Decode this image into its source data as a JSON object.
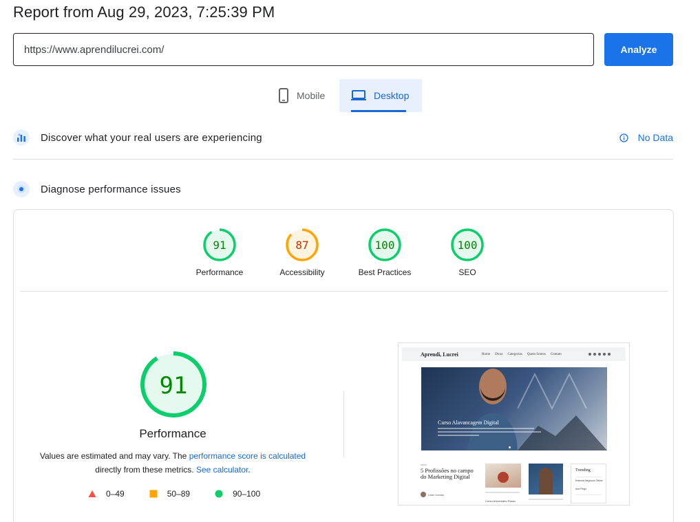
{
  "report": {
    "title": "Report from Aug 29, 2023, 7:25:39 PM"
  },
  "search": {
    "url_value": "https://www.aprendilucrei.com/",
    "analyze_label": "Analyze"
  },
  "device_tabs": {
    "mobile_label": "Mobile",
    "desktop_label": "Desktop",
    "selected": "Desktop"
  },
  "sections": {
    "real_users": {
      "label": "Discover what your real users are experiencing",
      "status": "No Data"
    },
    "diagnose": {
      "label": "Diagnose performance issues"
    }
  },
  "scores": [
    {
      "value": "91",
      "label": "Performance",
      "color": "#0cce6b",
      "text_color": "#008800",
      "bg": "#e6f9ee"
    },
    {
      "value": "87",
      "label": "Accessibility",
      "color": "#ffa400",
      "text_color": "#c33300",
      "bg": "#fff4e0"
    },
    {
      "value": "100",
      "label": "Best Practices",
      "color": "#0cce6b",
      "text_color": "#008800",
      "bg": "#e6f9ee"
    },
    {
      "value": "100",
      "label": "SEO",
      "color": "#0cce6b",
      "text_color": "#008800",
      "bg": "#e6f9ee"
    }
  ],
  "performance": {
    "score": "91",
    "label": "Performance",
    "note_prefix": "Values are estimated and may vary. The",
    "note_link1": "performance score is calculated",
    "note_middle": "directly from these metrics.",
    "note_link2": "See calculator",
    "note_suffix": "."
  },
  "legend": [
    {
      "range": "0–49",
      "shape": "triangle",
      "color": "#ff4e42"
    },
    {
      "range": "50–89",
      "shape": "square",
      "color": "#ffa400"
    },
    {
      "range": "90–100",
      "shape": "circle",
      "color": "#0cce6b"
    }
  ],
  "page_screenshot": {
    "brand": "Aprendi, Lucrei",
    "nav_links": [
      "Home",
      "Dicas",
      "Categorias",
      "Quem Somos",
      "Contato"
    ],
    "hero_title": "Curso Alavancagem Digital",
    "kicker": "NEWS",
    "post_title": "5 Profissões no campo do Marketing Digital",
    "author": "Lilian Dantas",
    "caption": "Curso Aniversário Passo",
    "trending_title": "Trending",
    "trending_items": [
      "Entenda Negócios Online",
      "Ana Pingo"
    ]
  }
}
